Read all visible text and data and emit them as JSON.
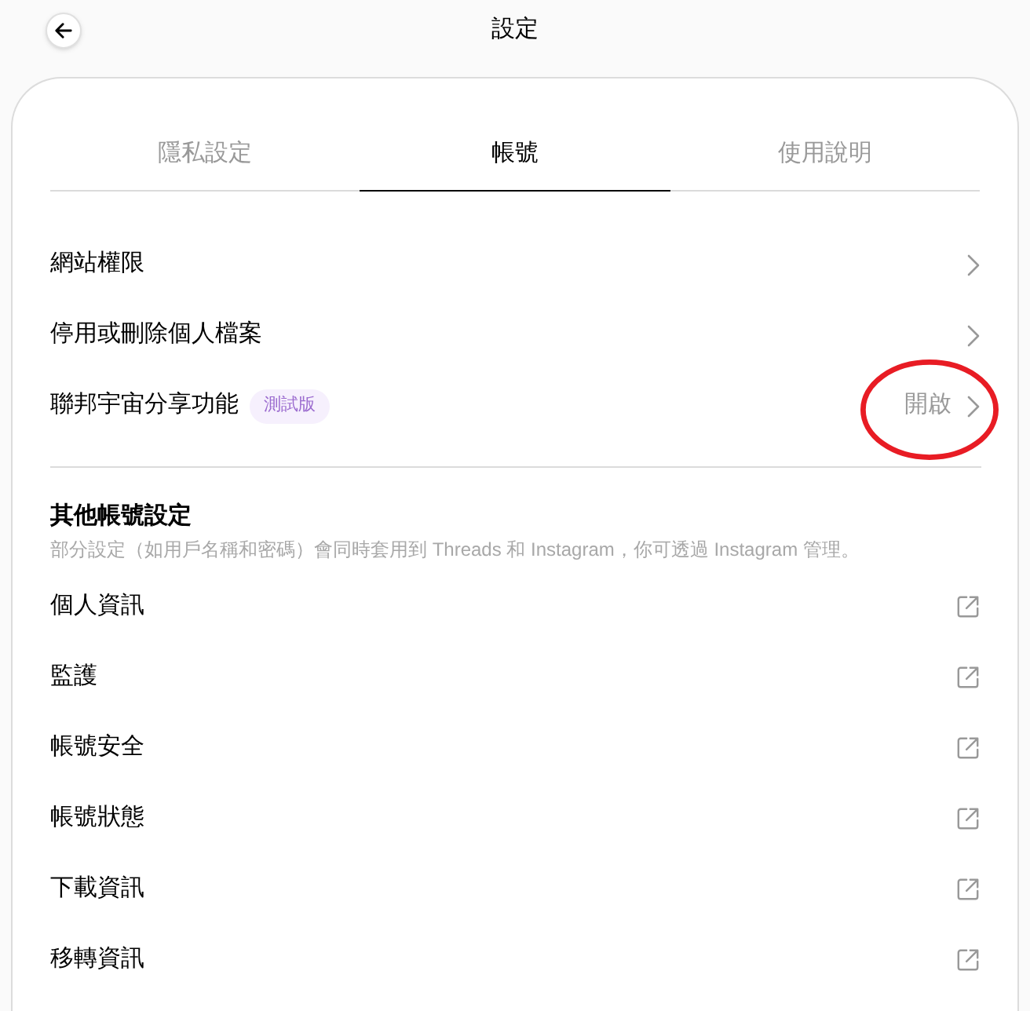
{
  "header": {
    "title": "設定"
  },
  "tabs": [
    {
      "label": "隱私設定",
      "selected": false
    },
    {
      "label": "帳號",
      "selected": true
    },
    {
      "label": "使用說明",
      "selected": false
    }
  ],
  "items": [
    {
      "kind": "link",
      "label": "網站權限",
      "circled": false
    },
    {
      "kind": "link",
      "label": "停用或刪除個人檔案",
      "circled": false
    },
    {
      "kind": "link",
      "label": "聯邦宇宙分享功能",
      "badge": "測試版",
      "value": "開啟",
      "circled": true
    }
  ],
  "other_section": {
    "title": "其他帳號設定",
    "description": "部分設定（如用戶名稱和密碼）會同時套用到 Threads 和 Instagram，你可透過 Instagram 管理。",
    "items": [
      {
        "kind": "external",
        "label": "個人資訊"
      },
      {
        "kind": "external",
        "label": "監護"
      },
      {
        "kind": "external",
        "label": "帳號安全"
      },
      {
        "kind": "external",
        "label": "帳號狀態"
      },
      {
        "kind": "external",
        "label": "下載資訊"
      },
      {
        "kind": "external",
        "label": "移轉資訊"
      }
    ]
  }
}
